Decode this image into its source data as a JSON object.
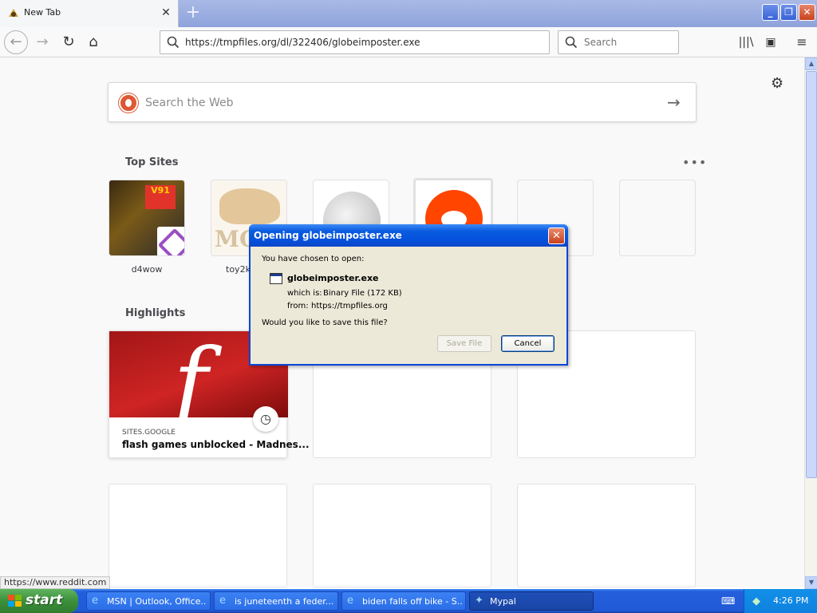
{
  "browser": {
    "tab": {
      "title": "New Tab",
      "close": "✕"
    },
    "new_tab": "+",
    "window_controls": {
      "minimize": "_",
      "maximize": "❐",
      "close": "✕"
    },
    "nav": {
      "back": "←",
      "forward": "→",
      "reload": "↻",
      "home": "⌂",
      "url": "https://tmpfiles.org/dl/322406/globeimposter.exe",
      "search_placeholder": "Search",
      "search_icon": "search-icon",
      "library": "|||\\",
      "sidebar": "▣",
      "menu": "≡"
    }
  },
  "newtab": {
    "search_placeholder": "Search the Web",
    "search_arrow": "→",
    "settings_icon": "⚙",
    "top_sites_title": "Top Sites",
    "more_icon": "•••",
    "top_sites": [
      {
        "label": "d4wow",
        "sign": "V91"
      },
      {
        "label": "toy2k.pole",
        "text": "MC"
      },
      {
        "label": ""
      },
      {
        "label": ""
      },
      {
        "label": ""
      },
      {
        "label": ""
      }
    ],
    "highlights_title": "Highlights",
    "highlight": {
      "source": "SITES.GOOGLE",
      "title": "flash games unblocked - Madnes...",
      "letter": "f",
      "clock": "◷"
    }
  },
  "status_url": "https://www.reddit.com",
  "dialog": {
    "title": "Opening globeimposter.exe",
    "close": "✕",
    "intro": "You have chosen to open:",
    "filename": "globeimposter.exe",
    "type_label": "which is:",
    "type_value": "Binary File (172 KB)",
    "from_label": "from:",
    "from_value": "https://tmpfiles.org",
    "question": "Would you like to save this file?",
    "save_button": "Save File",
    "cancel_button": "Cancel"
  },
  "taskbar": {
    "start": "start",
    "tasks": [
      {
        "label": "MSN | Outlook, Office...",
        "icon": "e"
      },
      {
        "label": "is juneteenth a feder...",
        "icon": "e"
      },
      {
        "label": "biden falls off bike - S...",
        "icon": "e"
      },
      {
        "label": "Mypal",
        "icon": "✦"
      }
    ],
    "keyboard": "⌨",
    "network": "◆",
    "clock": "4:26 PM"
  },
  "scrollbar": {
    "up": "▲",
    "down": "▼"
  },
  "colors": {
    "accent_blue": "#0a5ce0",
    "start_green": "#3c8f3b",
    "reddit": "#ff4500",
    "flash_red": "#cf2424"
  }
}
